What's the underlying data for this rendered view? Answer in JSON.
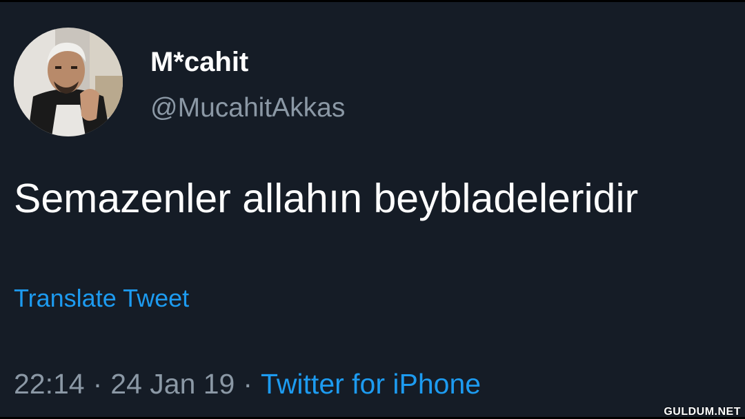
{
  "tweet": {
    "display_name": "M*cahit",
    "handle": "@MucahitAkkas",
    "text": "Semazenler allahın beybladeleridir",
    "translate_label": "Translate Tweet",
    "time": "22:14",
    "date": "24 Jan 19",
    "separator": "·",
    "source": "Twitter for iPhone"
  },
  "watermark": "GULDUM.NET",
  "colors": {
    "background": "#151c26",
    "text_primary": "#ffffff",
    "text_secondary": "#8b98a5",
    "link": "#1d9bf0"
  }
}
